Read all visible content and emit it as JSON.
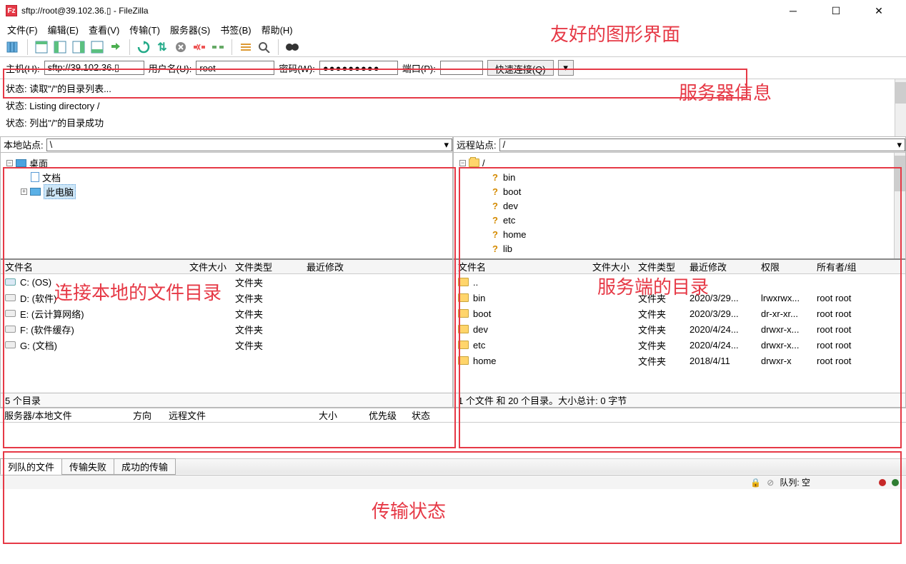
{
  "title": "sftp://root@39.102.36.▯ - FileZilla",
  "menu": [
    "文件(F)",
    "编辑(E)",
    "查看(V)",
    "传输(T)",
    "服务器(S)",
    "书签(B)",
    "帮助(H)"
  ],
  "conn": {
    "host_label": "主机(H):",
    "host": "sftp://39.102.36.▯",
    "user_label": "用户名(U):",
    "user": "root",
    "pass_label": "密码(W):",
    "pass": "●●●●●●●●●",
    "port_label": "端口(P):",
    "port": "",
    "quick": "快速连接(Q)"
  },
  "log": [
    "状态:  读取\"/\"的目录列表...",
    "状态:  Listing directory /",
    "状态:  列出\"/\"的目录成功"
  ],
  "local": {
    "label": "本地站点:",
    "path": "\\",
    "tree": [
      {
        "expander": "−",
        "icon": "desktop",
        "name": "桌面",
        "indent": 0
      },
      {
        "expander": "",
        "icon": "doc",
        "name": "文档",
        "indent": 1
      },
      {
        "expander": "+",
        "icon": "pc",
        "name": "此电脑",
        "indent": 1,
        "selected": true
      }
    ],
    "cols": [
      "文件名",
      "文件大小",
      "文件类型",
      "最近修改"
    ],
    "files": [
      {
        "name": "C: (OS)",
        "type": "文件夹",
        "icon": "sysdrive"
      },
      {
        "name": "D: (软件)",
        "type": "文件夹",
        "icon": "drive"
      },
      {
        "name": "E: (云计算网络)",
        "type": "文件夹",
        "icon": "drive"
      },
      {
        "name": "F: (软件缓存)",
        "type": "文件夹",
        "icon": "drive"
      },
      {
        "name": "G: (文档)",
        "type": "文件夹",
        "icon": "drive"
      }
    ],
    "status": "5 个目录"
  },
  "remote": {
    "label": "远程站点:",
    "path": "/",
    "tree": [
      {
        "expander": "−",
        "icon": "folder",
        "name": "/",
        "indent": 0
      },
      {
        "expander": "",
        "icon": "q",
        "name": "bin",
        "indent": 1
      },
      {
        "expander": "",
        "icon": "q",
        "name": "boot",
        "indent": 1
      },
      {
        "expander": "",
        "icon": "q",
        "name": "dev",
        "indent": 1
      },
      {
        "expander": "",
        "icon": "q",
        "name": "etc",
        "indent": 1
      },
      {
        "expander": "",
        "icon": "q",
        "name": "home",
        "indent": 1
      },
      {
        "expander": "",
        "icon": "q",
        "name": "lib",
        "indent": 1
      }
    ],
    "cols": [
      "文件名",
      "文件大小",
      "文件类型",
      "最近修改",
      "权限",
      "所有者/组"
    ],
    "files": [
      {
        "name": "..",
        "type": "",
        "mod": "",
        "perm": "",
        "own": "",
        "icon": "folder"
      },
      {
        "name": "bin",
        "type": "文件夹",
        "mod": "2020/3/29...",
        "perm": "lrwxrwx...",
        "own": "root root",
        "icon": "folder"
      },
      {
        "name": "boot",
        "type": "文件夹",
        "mod": "2020/3/29...",
        "perm": "dr-xr-xr...",
        "own": "root root",
        "icon": "folder"
      },
      {
        "name": "dev",
        "type": "文件夹",
        "mod": "2020/4/24...",
        "perm": "drwxr-x...",
        "own": "root root",
        "icon": "folder"
      },
      {
        "name": "etc",
        "type": "文件夹",
        "mod": "2020/4/24...",
        "perm": "drwxr-x...",
        "own": "root root",
        "icon": "folder"
      },
      {
        "name": "home",
        "type": "文件夹",
        "mod": "2018/4/11",
        "perm": "drwxr-x",
        "own": "root root",
        "icon": "folder"
      }
    ],
    "status": "1 个文件 和 20 个目录。大小总计: 0 字节"
  },
  "xfer": {
    "cols": [
      "服务器/本地文件",
      "方向",
      "远程文件",
      "大小",
      "优先级",
      "状态"
    ],
    "tabs": [
      "列队的文件",
      "传输失败",
      "成功的传输"
    ]
  },
  "bottom": {
    "queue": "队列: 空"
  },
  "annotations": {
    "ui": "友好的图形界面",
    "server_info": "服务器信息",
    "local_dir": "连接本地的文件目录",
    "remote_dir": "服务端的目录",
    "xfer_status": "传输状态"
  }
}
